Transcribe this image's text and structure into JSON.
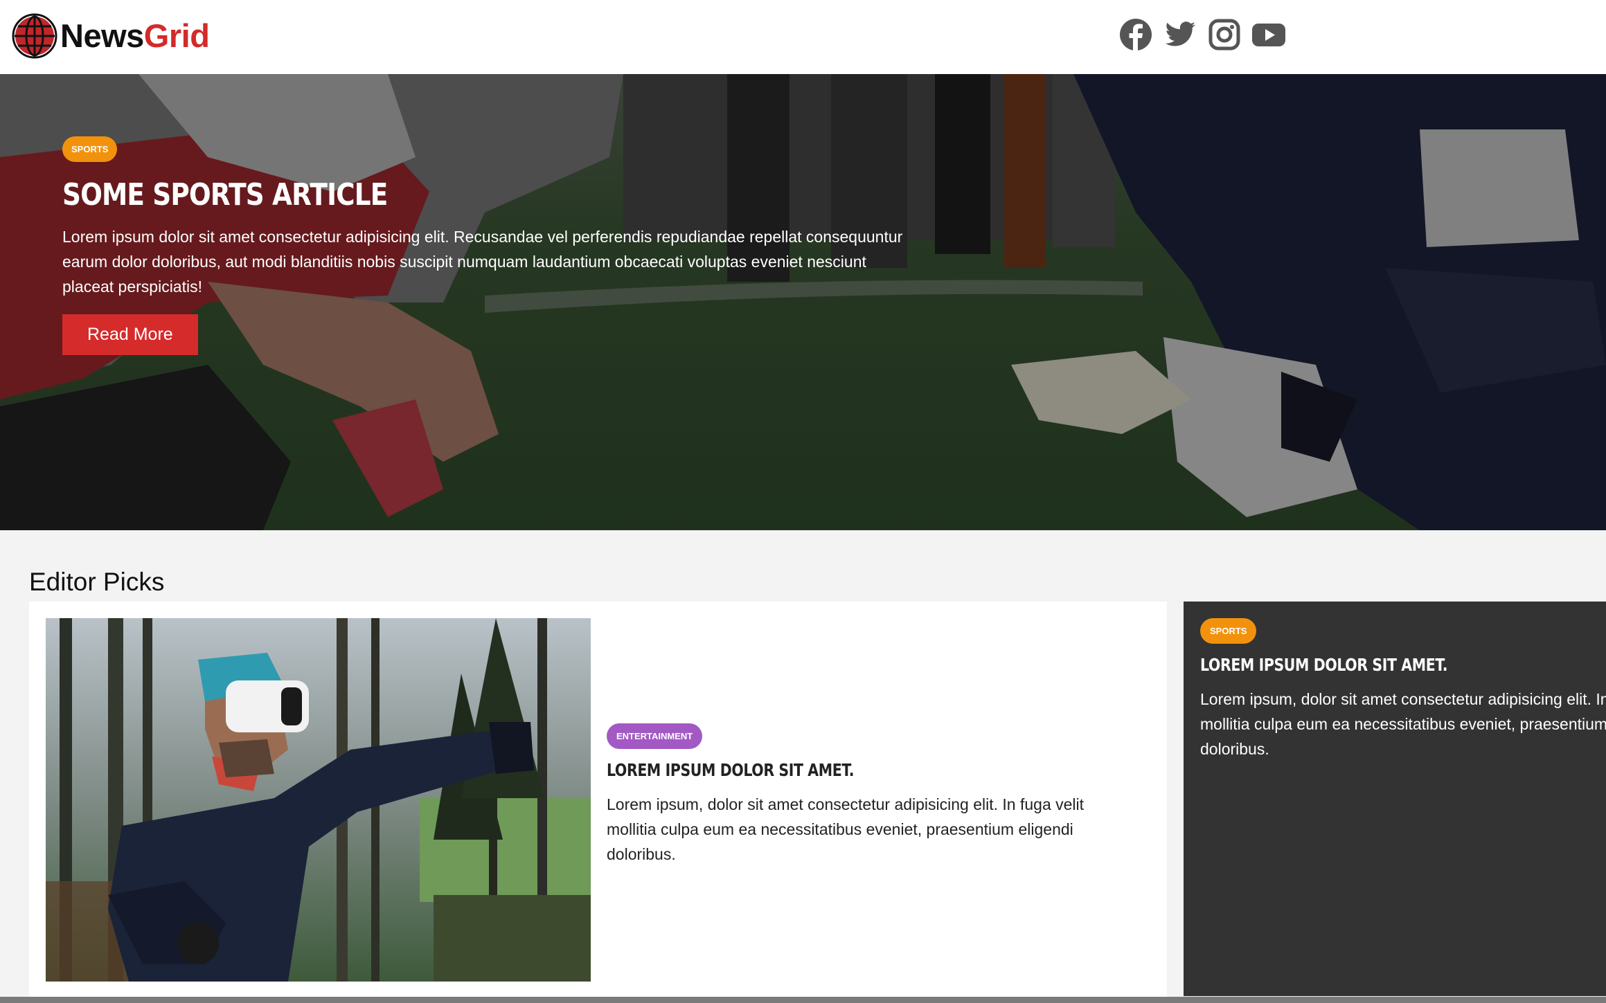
{
  "header": {
    "logo_news": "News",
    "logo_grid": "Grid",
    "socials": [
      "facebook-icon",
      "twitter-icon",
      "instagram-icon",
      "youtube-icon"
    ]
  },
  "hero": {
    "badge": "SPORTS",
    "title": "SOME SPORTS ARTICLE",
    "text": "Lorem ipsum dolor sit amet consectetur adipisicing elit. Recusandae vel perferendis repudiandae repellat consequuntur earum dolor doloribus, aut modi blanditiis nobis suscipit numquam laudantium obcaecati voluptas eveniet nesciunt placeat perspiciatis!",
    "button": "Read More"
  },
  "editor_picks": {
    "heading": "Editor Picks",
    "cards": [
      {
        "badge": "ENTERTAINMENT",
        "title": "LOREM IPSUM DOLOR SIT AMET.",
        "text": "Lorem ipsum, dolor sit amet consectetur adipisicing elit. In fuga velit mollitia culpa eum ea necessitatibus eveniet, praesentium eligendi doloribus."
      },
      {
        "badge": "SPORTS",
        "title": "LOREM IPSUM DOLOR SIT AMET.",
        "text": "Lorem ipsum, dolor sit amet consectetur adipisicing elit. In fuga velit mollitia culpa eum ea necessitatibus eveniet, praesentium eligendi doloribus."
      }
    ]
  },
  "colors": {
    "brand_red": "#d32a2a",
    "sports_badge": "#f2920c",
    "entertainment_badge": "#a259c4",
    "dark_card": "#333333"
  }
}
